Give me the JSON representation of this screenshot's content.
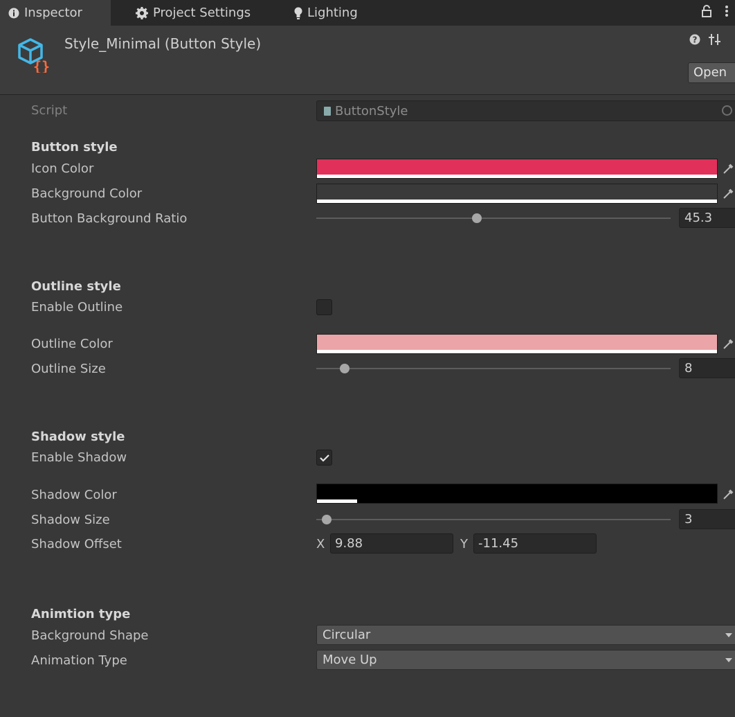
{
  "tabs": [
    {
      "label": "Inspector",
      "icon": "info-icon",
      "active": true
    },
    {
      "label": "Project Settings",
      "icon": "gear-icon",
      "active": false
    },
    {
      "label": "Lighting",
      "icon": "lightbulb-icon",
      "active": false
    }
  ],
  "header": {
    "title": "Style_Minimal (Button Style)",
    "open_label": "Open",
    "icons": [
      "help-icon",
      "preset-icon",
      "more-icon",
      "lock-icon"
    ]
  },
  "script": {
    "label": "Script",
    "value": "ButtonStyle"
  },
  "button_style": {
    "heading": "Button style",
    "icon_color_label": "Icon Color",
    "icon_color": "#e1305a",
    "icon_alpha": 1.0,
    "background_color_label": "Background Color",
    "background_color": "#3a3a3a",
    "background_alpha": 1.0,
    "ratio_label": "Button Background Ratio",
    "ratio_value": "45.3",
    "ratio_min": 0,
    "ratio_max": 100
  },
  "outline_style": {
    "heading": "Outline style",
    "enable_label": "Enable Outline",
    "enabled": false,
    "color_label": "Outline Color",
    "color": "#eba4a7",
    "alpha": 1.0,
    "size_label": "Outline Size",
    "size_value": "8",
    "size_min": 0,
    "size_max": 100
  },
  "shadow_style": {
    "heading": "Shadow style",
    "enable_label": "Enable Shadow",
    "enabled": true,
    "color_label": "Shadow Color",
    "color": "#000000",
    "alpha": 0.1,
    "size_label": "Shadow Size",
    "size_value": "3",
    "size_min": 0,
    "size_max": 100,
    "offset_label": "Shadow Offset",
    "offset_x_label": "X",
    "offset_x": "9.88",
    "offset_y_label": "Y",
    "offset_y": "-11.45"
  },
  "animation": {
    "heading": "Animtion type",
    "shape_label": "Background Shape",
    "shape_value": "Circular",
    "type_label": "Animation Type",
    "type_value": "Move Up"
  }
}
